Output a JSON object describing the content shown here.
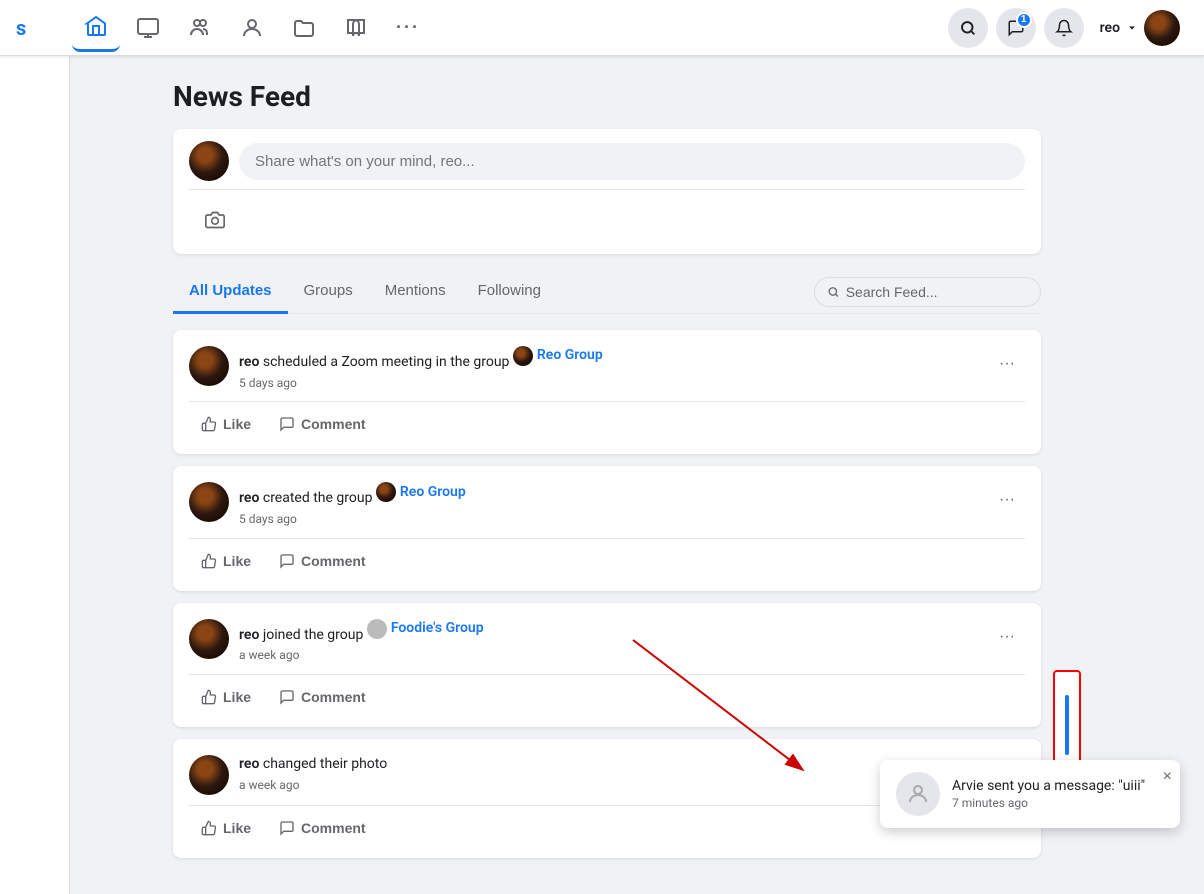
{
  "app": {
    "name": "s",
    "title": "News Feed"
  },
  "nav": {
    "logo": "s",
    "user": {
      "name": "reo",
      "avatar_alt": "reo avatar"
    },
    "icons": [
      {
        "name": "home-icon",
        "symbol": "⊞",
        "active": true
      },
      {
        "name": "twitch-icon",
        "symbol": "🎮",
        "active": false
      },
      {
        "name": "people-icon",
        "symbol": "👥",
        "active": false
      },
      {
        "name": "person-icon",
        "symbol": "👤",
        "active": false
      },
      {
        "name": "folder-icon",
        "symbol": "📁",
        "active": false
      },
      {
        "name": "book-icon",
        "symbol": "📖",
        "active": false
      },
      {
        "name": "more-icon",
        "symbol": "···",
        "active": false
      }
    ],
    "right_icons": [
      {
        "name": "search-icon",
        "symbol": "🔍"
      },
      {
        "name": "messages-icon",
        "symbol": "💬",
        "badge": "1"
      },
      {
        "name": "bell-icon",
        "symbol": "🔔"
      }
    ]
  },
  "post_box": {
    "placeholder": "Share what's on your mind, reo...",
    "camera_icon": "📷"
  },
  "feed_tabs": {
    "tabs": [
      {
        "id": "all-updates",
        "label": "All Updates",
        "active": true
      },
      {
        "id": "groups",
        "label": "Groups",
        "active": false
      },
      {
        "id": "mentions",
        "label": "Mentions",
        "active": false
      },
      {
        "id": "following",
        "label": "Following",
        "active": false
      }
    ],
    "search_placeholder": "Search Feed..."
  },
  "feed_items": [
    {
      "id": 1,
      "user": "reo",
      "action": "scheduled a Zoom meeting in the group",
      "group_name": "Reo Group",
      "time": "5 days ago",
      "like_label": "Like",
      "comment_label": "Comment"
    },
    {
      "id": 2,
      "user": "reo",
      "action": "created the group",
      "group_name": "Reo Group",
      "time": "5 days ago",
      "like_label": "Like",
      "comment_label": "Comment"
    },
    {
      "id": 3,
      "user": "reo",
      "action": "joined the group",
      "group_name": "Foodie's Group",
      "time": "a week ago",
      "like_label": "Like",
      "comment_label": "Comment",
      "group_type": "grey"
    },
    {
      "id": 4,
      "user": "reo",
      "action": "changed their photo",
      "group_name": "",
      "time": "a week ago",
      "like_label": "Like",
      "comment_label": "Comment"
    }
  ],
  "notification": {
    "message": "Arvie sent you a message: \"uiii\"",
    "time": "7 minutes ago",
    "close_label": "×"
  },
  "scrollbar_box": {
    "visible": true
  }
}
